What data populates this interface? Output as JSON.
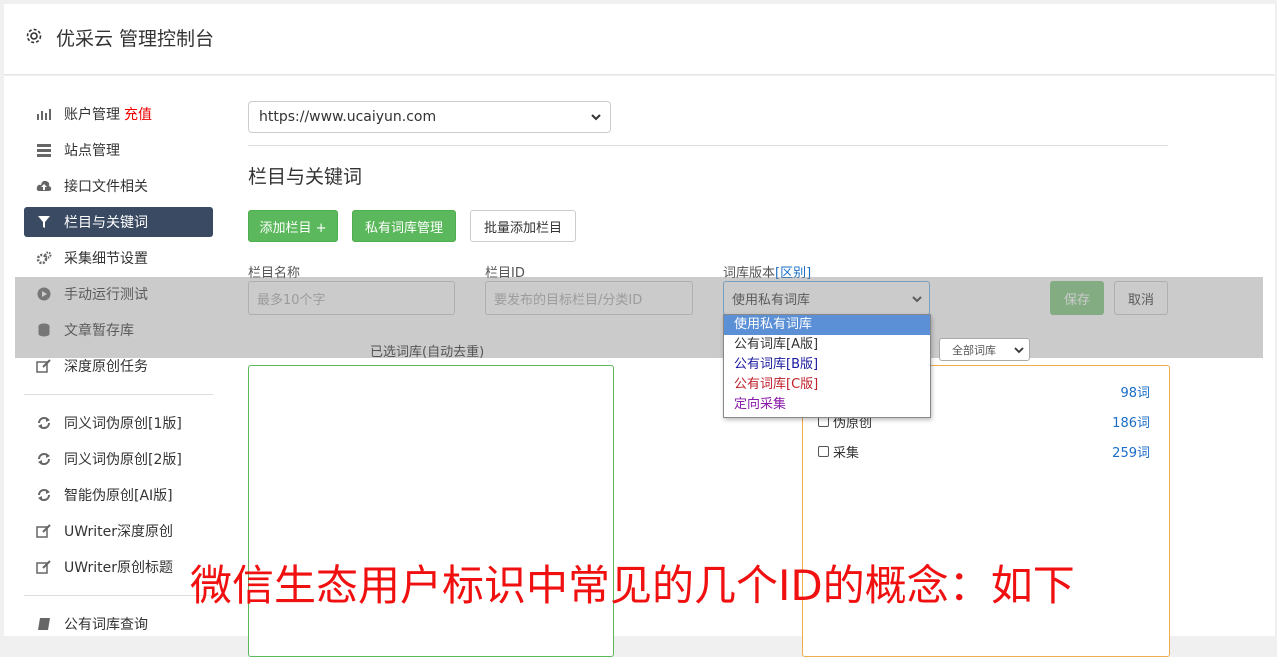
{
  "header": {
    "title": "优采云 管理控制台",
    "icon": "gear-icon"
  },
  "sidebar": {
    "items": [
      {
        "label": "账户管理",
        "extra": "充值",
        "icon": "bar-chart-icon"
      },
      {
        "label": "站点管理",
        "icon": "server-icon"
      },
      {
        "label": "接口文件相关",
        "icon": "cloud-upload-icon"
      },
      {
        "label": "栏目与关键词",
        "icon": "filter-icon",
        "active": true
      },
      {
        "label": "采集细节设置",
        "icon": "cogs-icon"
      },
      {
        "label": "手动运行测试",
        "icon": "play-icon"
      },
      {
        "label": "文章暂存库",
        "icon": "database-icon"
      },
      {
        "label": "深度原创任务",
        "icon": "edit-icon"
      },
      {
        "label": "同义词伪原创[1版]",
        "icon": "refresh-icon"
      },
      {
        "label": "同义词伪原创[2版]",
        "icon": "refresh-icon"
      },
      {
        "label": "智能伪原创[AI版]",
        "icon": "refresh-icon"
      },
      {
        "label": "UWriter深度原创",
        "icon": "edit-icon"
      },
      {
        "label": "UWriter原创标题",
        "icon": "edit-icon"
      },
      {
        "label": "公有词库查询",
        "icon": "book-icon"
      }
    ]
  },
  "site_select": {
    "value": "https://www.ucaiyun.com"
  },
  "section_title": "栏目与关键词",
  "buttons": {
    "add_column": "添加栏目 +",
    "private_lib": "私有词库管理",
    "batch_add": "批量添加栏目",
    "save": "保存",
    "cancel": "取消"
  },
  "form": {
    "name_label": "栏目名称",
    "name_placeholder": "最多10个字",
    "id_label": "栏目ID",
    "id_placeholder": "要发布的目标栏目/分类ID",
    "version_label": "词库版本",
    "version_link": "[区别]",
    "version_value": "使用私有词库"
  },
  "dropdown": {
    "options": [
      {
        "label": "使用私有词库",
        "color": "#ffffff"
      },
      {
        "label": "公有词库[A版]",
        "color": "#333333"
      },
      {
        "label": "公有词库[B版]",
        "color": "#1a1aa0"
      },
      {
        "label": "公有词库[C版]",
        "color": "#c0202a"
      },
      {
        "label": "定向采集",
        "color": "#8a1aa8"
      }
    ]
  },
  "selected_caption": "已选词库(自动去重)",
  "filter": {
    "value": "全部词库"
  },
  "libraries": [
    {
      "label": "",
      "count": "98词"
    },
    {
      "label": "伪原创",
      "count": "186词"
    },
    {
      "label": "采集",
      "count": "259词"
    }
  ],
  "watermark": "微信生态用户标识中常见的几个ID的概念：如下"
}
